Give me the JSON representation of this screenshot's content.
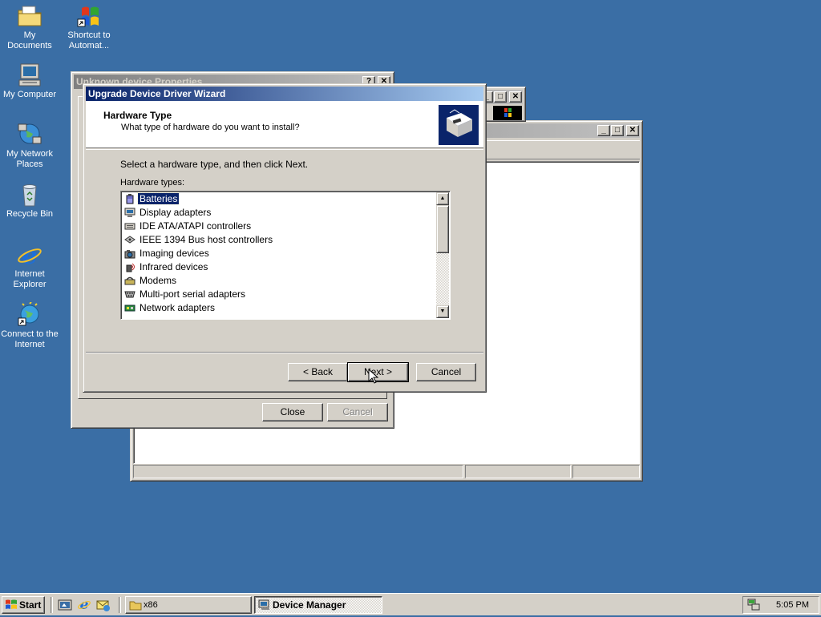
{
  "desktop": {
    "icons": [
      {
        "label": "My Documents",
        "icon": "folder-documents-icon"
      },
      {
        "label": "Shortcut to Automat...",
        "icon": "windows-flag-shortcut-icon"
      },
      {
        "label": "My Computer",
        "icon": "computer-icon"
      },
      {
        "label": "My Network Places",
        "icon": "network-places-icon"
      },
      {
        "label": "Recycle Bin",
        "icon": "recycle-bin-icon"
      },
      {
        "label": "Internet Explorer",
        "icon": "internet-explorer-icon"
      },
      {
        "label": "Connect to the Internet",
        "icon": "connect-internet-icon"
      }
    ]
  },
  "properties_window": {
    "title": "Unknown device Properties",
    "close_label": "Close",
    "cancel_label": "Cancel"
  },
  "device_manager_window": {
    "title": ""
  },
  "wizard": {
    "title": "Upgrade Device Driver Wizard",
    "heading": "Hardware Type",
    "subheading": "What type of hardware do you want to install?",
    "instruction": "Select a hardware type, and then click Next.",
    "list_label": "Hardware types:",
    "hardware_types": [
      {
        "label": "Batteries",
        "icon": "battery-icon",
        "selected": true
      },
      {
        "label": "Display adapters",
        "icon": "monitor-icon",
        "selected": false
      },
      {
        "label": "IDE ATA/ATAPI controllers",
        "icon": "ide-controller-icon",
        "selected": false
      },
      {
        "label": "IEEE 1394 Bus host controllers",
        "icon": "firewire-icon",
        "selected": false
      },
      {
        "label": "Imaging devices",
        "icon": "camera-icon",
        "selected": false
      },
      {
        "label": "Infrared devices",
        "icon": "infrared-icon",
        "selected": false
      },
      {
        "label": "Modems",
        "icon": "modem-icon",
        "selected": false
      },
      {
        "label": "Multi-port serial adapters",
        "icon": "serial-port-icon",
        "selected": false
      },
      {
        "label": "Network adapters",
        "icon": "network-adapter-icon",
        "selected": false
      }
    ],
    "back_label": "< Back",
    "next_label": "Next >",
    "cancel_label": "Cancel"
  },
  "taskbar": {
    "start_label": "Start",
    "tasks": [
      {
        "label": "x86",
        "icon": "folder-icon",
        "active": false
      },
      {
        "label": "Device Manager",
        "icon": "device-manager-icon",
        "active": true
      }
    ],
    "clock": "5:05 PM"
  },
  "colors": {
    "desktop": "#3a6ea5",
    "active_title": "#0a246a",
    "face": "#d4d0c8",
    "selection": "#0a246a"
  }
}
